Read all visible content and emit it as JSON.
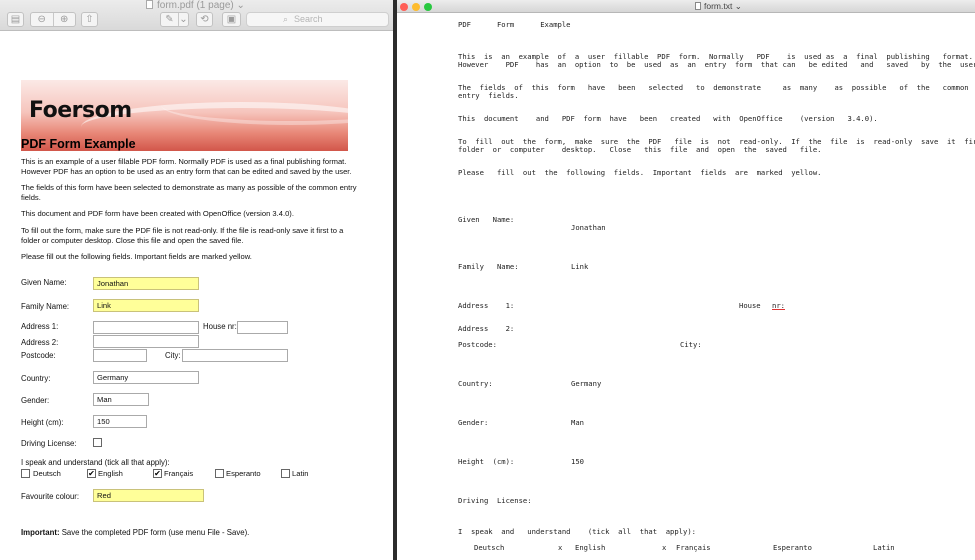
{
  "pdf_window": {
    "title": "form.pdf (1 page)",
    "search_placeholder": "Search",
    "banner_logo": "Foersom",
    "heading": "PDF Form Example",
    "paragraphs": [
      "This is an example of a user fillable PDF form. Normally PDF is used as a final publishing format. However PDF has an option to be used as an entry form that can be edited and saved by the user.",
      "The fields of this form have been selected to demonstrate as many as possible of the common entry fields.",
      "This document and PDF form have been created with OpenOffice (version 3.4.0).",
      "To fill out the form, make sure the PDF file is not read-only. If the file is read-only save it first to a folder or computer desktop. Close this file and open the saved file.",
      "Please fill out the following fields. Important fields are marked yellow."
    ],
    "labels": {
      "given_name": "Given Name:",
      "family_name": "Family Name:",
      "address1": "Address 1:",
      "house_nr": "House nr:",
      "address2": "Address 2:",
      "postcode": "Postcode:",
      "city": "City:",
      "country": "Country:",
      "gender": "Gender:",
      "height": "Height (cm):",
      "driving_license": "Driving License:",
      "languages": "I speak and understand (tick all that apply):",
      "favourite_colour": "Favourite colour:"
    },
    "values": {
      "given_name": "Jonathan",
      "family_name": "Link",
      "address1": "",
      "house_nr": "",
      "address2": "",
      "postcode": "",
      "city": "",
      "country": "Germany",
      "gender": "Man",
      "height": "150",
      "favourite_colour": "Red"
    },
    "languages": [
      {
        "label": "Deutsch",
        "checked": false,
        "mark": ""
      },
      {
        "label": "English",
        "checked": true,
        "mark": "✔"
      },
      {
        "label": "Français",
        "checked": true,
        "mark": "✔"
      },
      {
        "label": "Esperanto",
        "checked": false,
        "mark": ""
      },
      {
        "label": "Latin",
        "checked": false,
        "mark": ""
      }
    ],
    "footer_bold": "Important:",
    "footer_text": " Save the completed PDF form (use menu File - Save)."
  },
  "text_window": {
    "title": "form.txt",
    "lines": {
      "title": "PDF      Form      Example",
      "p1a": "This  is  an  example  of  a  user  fillable  PDF  form.  Normally   PDF    is  used as  a  final  publishing   format.",
      "p1b": "However    PDF    has  an  option  to  be  used  as  an  entry  form  that can   be edited   and   saved   by  the  user.",
      "p2a": "The  fields  of  this  form   have   been   selected   to  demonstrate     as  many    as  possible   of  the   common",
      "p2b": "entry  fields.",
      "p3": "This  document    and   PDF  form  have   been   created   with  OpenOffice    (version   3.4.0).",
      "p4a": "To  fill  out  the  form,  make  sure  the  PDF   file  is  not  read-only.  If  the  file  is  read-only  save  it  first  to  a",
      "p4b": "folder  or  computer    desktop.   Close   this  file  and  open  the  saved   file.",
      "p5": "Please   fill  out  the  following  fields.  Important  fields  are  marked  yellow.",
      "given_name_label": "Given   Name:",
      "given_name_value": "Jonathan",
      "family_name_label": "Family   Name:",
      "family_name_value": "Link",
      "address1_label": "Address    1:",
      "house_label": "House",
      "house_nr": "nr:",
      "address2_label": "Address    2:",
      "postcode_label": "Postcode:",
      "city_label": "City:",
      "country_label": "Country:",
      "country_value": "Germany",
      "gender_label": "Gender:",
      "gender_value": "Man",
      "height_label": "Height  (cm):",
      "height_value": "150",
      "driving_label": "Driving  License:",
      "languages_label": "I  speak  and   understand    (tick  all  that  apply):",
      "lang_deutsch": "Deutsch",
      "mark_english": "x",
      "lang_english": "English",
      "mark_francais": "x",
      "lang_francais": "Français",
      "lang_esperanto": "Esperanto",
      "lang_latin": "Latin"
    }
  },
  "colors": {
    "required_field": "#ffff99",
    "traffic_close": "#ff5f57",
    "traffic_min": "#febc2e",
    "traffic_max": "#28c840"
  }
}
